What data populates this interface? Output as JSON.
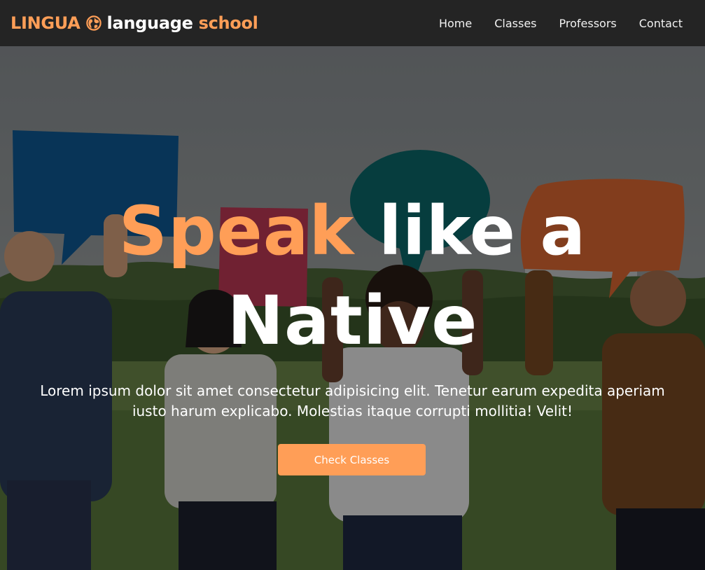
{
  "brand": {
    "name_part1": "LINGUA",
    "name_part2": "language",
    "name_part3": "school",
    "logo_icon": "globe-icon",
    "accent_color": "#ff9e57"
  },
  "nav": {
    "items": [
      {
        "label": "Home"
      },
      {
        "label": "Classes"
      },
      {
        "label": "Professors"
      },
      {
        "label": "Contact"
      }
    ]
  },
  "hero": {
    "title_accent": "Speak",
    "title_line1_rest": " like a",
    "title_line2": "Native",
    "description": "Lorem ipsum dolor sit amet consectetur adipisicing elit. Tenetur earum expedita aperiam iusto harum explicabo. Molestias itaque corrupti mollitia! Velit!",
    "cta_label": "Check Classes"
  }
}
